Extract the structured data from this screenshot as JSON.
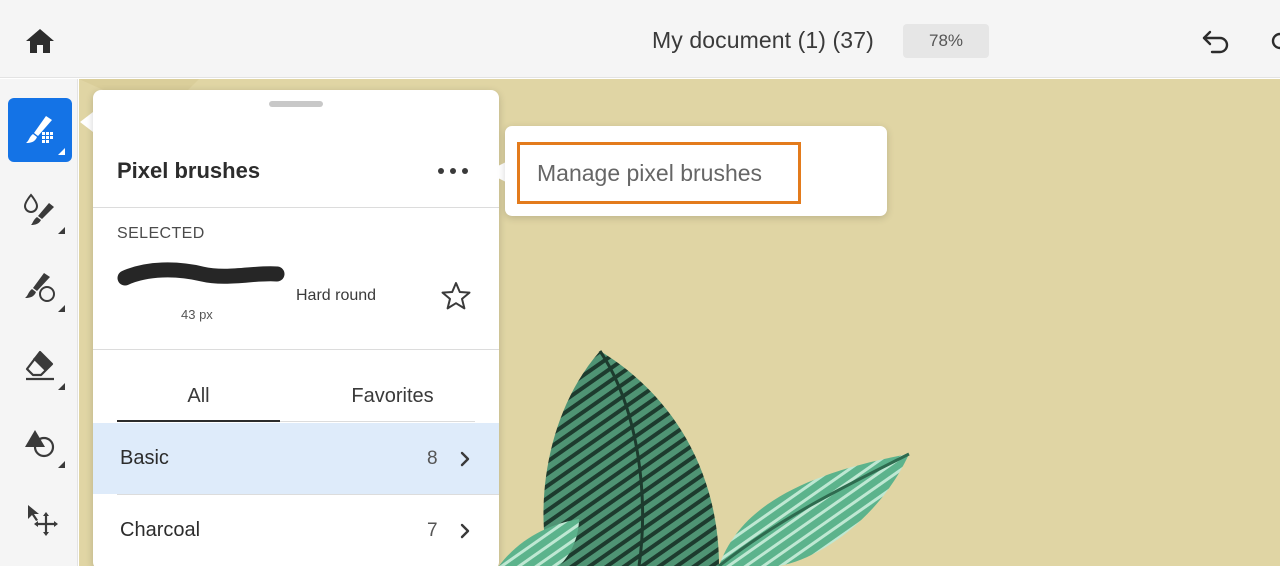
{
  "topbar": {
    "document_title": "My document (1) (37)",
    "zoom_level": "78%"
  },
  "icons": {
    "home": "home-icon",
    "undo": "undo-icon",
    "redo": "redo-icon",
    "more": "more-horizontal-icon",
    "star": "star-outline-icon",
    "chevron": "chevron-right-icon"
  },
  "toolbar": {
    "tools": [
      {
        "name": "pixel-brush-tool",
        "active": true
      },
      {
        "name": "watercolor-brush-tool",
        "active": false
      },
      {
        "name": "mixer-brush-tool",
        "active": false
      },
      {
        "name": "eraser-tool",
        "active": false
      },
      {
        "name": "shape-tool",
        "active": false
      },
      {
        "name": "move-tool",
        "active": false
      }
    ]
  },
  "brushes_panel": {
    "title": "Pixel brushes",
    "selected_label": "SELECTED",
    "selected_brush": {
      "size": "43 px",
      "name": "Hard round"
    },
    "tabs": [
      {
        "label": "All",
        "active": true
      },
      {
        "label": "Favorites",
        "active": false
      }
    ],
    "categories": [
      {
        "name": "Basic",
        "count": "8",
        "highlighted": true
      },
      {
        "name": "Charcoal",
        "count": "7",
        "highlighted": false
      }
    ]
  },
  "popover": {
    "menu_item": "Manage pixel brushes"
  },
  "colors": {
    "accent_blue": "#1473e6",
    "canvas": "#e0d5a4",
    "highlight_row": "#deebfa",
    "focus_ring": "#e37b1c",
    "leaf_dark": "#2e6b4f",
    "leaf_light": "#5cb38c"
  }
}
